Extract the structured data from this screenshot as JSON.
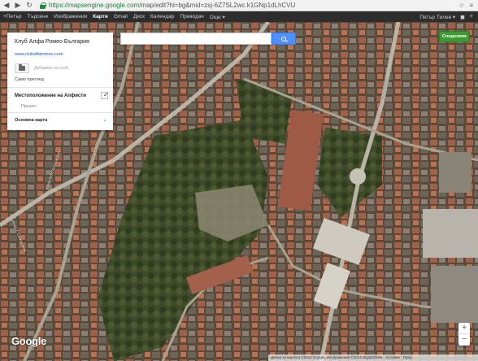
{
  "browser": {
    "url_host": "https://mapsengine.google.com",
    "url_rest": "/map/edit?hl=bg&mid=zsj-6Z7SL2wc.k1GNp1dLhCVU"
  },
  "google_bar": {
    "items": [
      "+Петър",
      "Търсене",
      "Изображения",
      "Карти",
      "Gmail",
      "Диск",
      "Календар",
      "Преводач",
      "Още ▾"
    ],
    "active_index": 3,
    "user": "Петър Тилев ▾"
  },
  "panel": {
    "title": "Клуб Алфа Ромео България",
    "link": "www.clubalfaromeo.com",
    "add_layer_hint": "Добавяне на слой",
    "view_only": "Само преглед",
    "layer_name": "Местоположение на Апфисти",
    "layer_empty": "Празен",
    "basemap_label": "Основна карта"
  },
  "search": {
    "placeholder": ""
  },
  "share": {
    "label": "Споделяне"
  },
  "map": {
    "logo": "Google",
    "attribution": "Данни за картата ©2014 Google, Изображения ©2014 DigitalGlobe · Условия · Пред",
    "streets": [
      "улица Т. Самодумов",
      "улица Княз Александър",
      "улица Гурко"
    ]
  },
  "zoom": {
    "in": "+",
    "out": "−"
  }
}
